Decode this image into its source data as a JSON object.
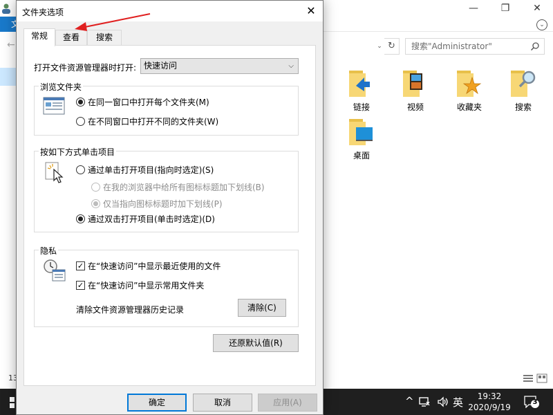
{
  "explorer": {
    "search_placeholder": "搜索\"Administrator\"",
    "file_tab": "文",
    "status_count": "13",
    "folders": [
      {
        "label": "链接",
        "icon": "links-folder-icon"
      },
      {
        "label": "视频",
        "icon": "videos-folder-icon"
      },
      {
        "label": "收藏夹",
        "icon": "favorites-folder-icon"
      },
      {
        "label": "搜索",
        "icon": "searches-folder-icon"
      },
      {
        "label": "桌面",
        "icon": "desktop-folder-icon"
      }
    ]
  },
  "taskbar": {
    "ime": "英",
    "time": "19:32",
    "date": "2020/9/19",
    "notification_count": "3"
  },
  "dialog": {
    "title": "文件夹选项",
    "close": "✕",
    "tabs": [
      "常规",
      "查看",
      "搜索"
    ],
    "open_explorer_label": "打开文件资源管理器时打开:",
    "open_explorer_value": "快速访问",
    "browse_group": {
      "title": "浏览文件夹",
      "options": [
        "在同一窗口中打开每个文件夹(M)",
        "在不同窗口中打开不同的文件夹(W)"
      ],
      "selected": 0
    },
    "click_group": {
      "title": "按如下方式单击项目",
      "single_click": "通过单击打开项目(指向时选定)(S)",
      "underline_all": "在我的浏览器中给所有图标标题加下划线(B)",
      "underline_hover": "仅当指向图标标题时加下划线(P)",
      "double_click": "通过双击打开项目(单击时选定)(D)"
    },
    "privacy_group": {
      "title": "隐私",
      "show_recent": "在“快速访问”中显示最近使用的文件",
      "show_frequent": "在“快速访问”中显示常用文件夹",
      "clear_label": "清除文件资源管理器历史记录",
      "clear_button": "清除(C)"
    },
    "restore_defaults": "还原默认值(R)",
    "ok": "确定",
    "cancel": "取消",
    "apply": "应用(A)"
  },
  "colors": {
    "accent": "#0078d7",
    "annotation_arrow": "#e02020",
    "taskbar": "#1f1f1f"
  }
}
